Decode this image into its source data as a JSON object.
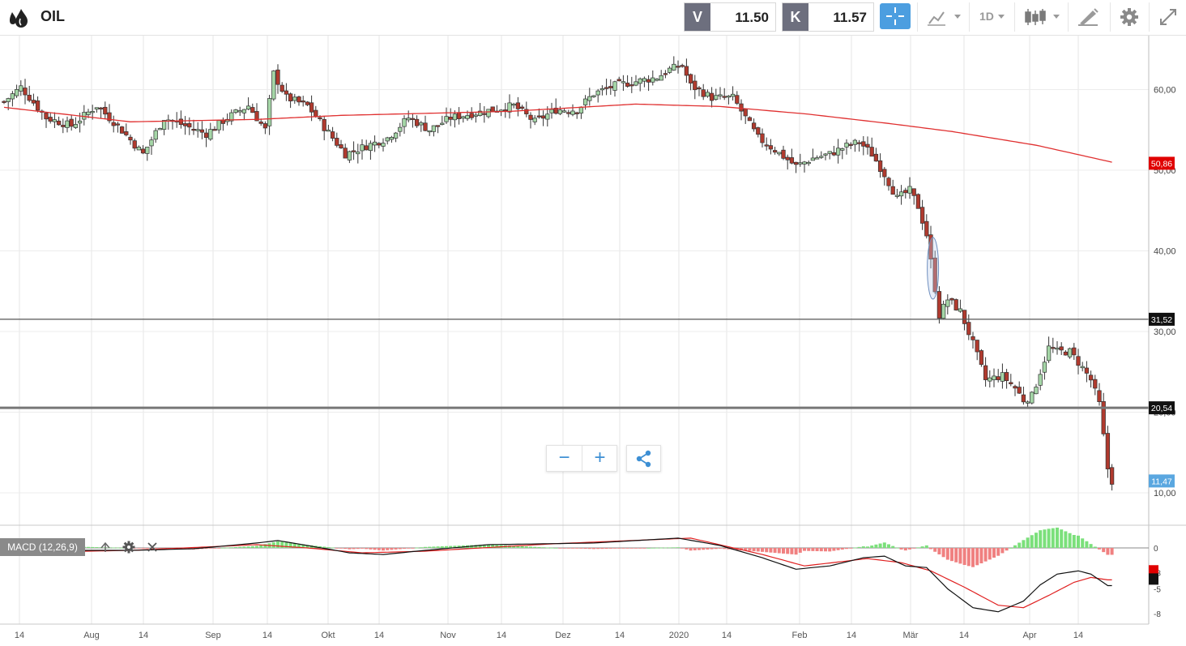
{
  "header": {
    "symbol": "OIL",
    "sell_tag": "V",
    "sell_value": "11.50",
    "buy_tag": "K",
    "buy_value": "11.57",
    "timeframe": "1D",
    "icons": [
      "oil-drop-icon",
      "crosshair-icon",
      "line-chart-icon",
      "candlestick-icon",
      "drawing-tool-icon",
      "gear-icon",
      "fullscreen-icon"
    ]
  },
  "colors": {
    "accent": "#4c9ee0",
    "up_candle": "#a5d6a7",
    "down_candle": "#b03a2e",
    "ma_line": "#e03030",
    "price_tag": "#5aa7e0",
    "macd_pos": "#7be07b",
    "macd_neg": "#f08080"
  },
  "zoom": {
    "minus": "−",
    "plus": "+",
    "share_icon": "share-icon"
  },
  "indicator": {
    "label": "MACD (12,26,9)",
    "tool_icons": [
      "move-icon",
      "gear-icon",
      "close-icon"
    ]
  },
  "chart_data": {
    "type": "candlestick",
    "price_axis": [
      "60,00",
      "50,00",
      "40,00",
      "30,00",
      "20,00",
      "10,00"
    ],
    "macd_axis": [
      "0",
      "-3",
      "-5",
      "-8"
    ],
    "x_ticks": [
      "14",
      "Aug",
      "14",
      "Sep",
      "14",
      "Okt",
      "14",
      "Nov",
      "14",
      "Dez",
      "14",
      "2020",
      "14",
      "Feb",
      "14",
      "Mär",
      "14",
      "Apr",
      "14"
    ],
    "markers": [
      {
        "label": "50,86",
        "value": 50.86,
        "color": "#e00000"
      },
      {
        "label": "31,52",
        "value": 31.52,
        "color": "#111111"
      },
      {
        "label": "20,54",
        "value": 20.54,
        "color": "#111111"
      },
      {
        "label": "11,47",
        "value": 11.47,
        "color": "#5aa7e0"
      }
    ],
    "macd_markers": [
      {
        "value": -2.8,
        "color": "#e00000"
      },
      {
        "value": -3.8,
        "color": "#111111"
      }
    ],
    "horizontal_lines": [
      31.52,
      20.54
    ],
    "anchors": [
      [
        0,
        58.5
      ],
      [
        4,
        60.3
      ],
      [
        10,
        56.5
      ],
      [
        16,
        55.5
      ],
      [
        22,
        58.0
      ],
      [
        27,
        55.5
      ],
      [
        33,
        52.0
      ],
      [
        38,
        56.5
      ],
      [
        43,
        55.5
      ],
      [
        48,
        54.5
      ],
      [
        53,
        56.5
      ],
      [
        58,
        58.0
      ],
      [
        62,
        55.0
      ],
      [
        64,
        62.0
      ],
      [
        67,
        59.0
      ],
      [
        72,
        58.0
      ],
      [
        78,
        54.0
      ],
      [
        81,
        52.0
      ],
      [
        86,
        53.0
      ],
      [
        91,
        54.0
      ],
      [
        96,
        56.5
      ],
      [
        101,
        55.0
      ],
      [
        106,
        56.5
      ],
      [
        111,
        57.0
      ],
      [
        116,
        57.5
      ],
      [
        121,
        58.0
      ],
      [
        126,
        56.0
      ],
      [
        131,
        57.5
      ],
      [
        136,
        57.5
      ],
      [
        140,
        59.5
      ],
      [
        145,
        60.5
      ],
      [
        150,
        61.0
      ],
      [
        155,
        61.5
      ],
      [
        158,
        62.5
      ],
      [
        161,
        63.0
      ],
      [
        163,
        60.5
      ],
      [
        168,
        59.0
      ],
      [
        173,
        59.0
      ],
      [
        176,
        56.5
      ],
      [
        179,
        54.0
      ],
      [
        183,
        52.5
      ],
      [
        188,
        50.5
      ],
      [
        192,
        51.5
      ],
      [
        196,
        52.0
      ],
      [
        200,
        53.0
      ],
      [
        203,
        53.5
      ],
      [
        206,
        52.0
      ],
      [
        209,
        49.5
      ],
      [
        212,
        46.5
      ],
      [
        215,
        47.5
      ],
      [
        217,
        45.5
      ],
      [
        219,
        42.0
      ],
      [
        222,
        32.0
      ],
      [
        224,
        34.0
      ],
      [
        227,
        32.5
      ],
      [
        230,
        28.5
      ],
      [
        233,
        24.0
      ],
      [
        237,
        24.5
      ],
      [
        240,
        23.0
      ],
      [
        242,
        21.5
      ],
      [
        244,
        22.0
      ],
      [
        246,
        25.0
      ],
      [
        248,
        28.0
      ],
      [
        250,
        27.5
      ],
      [
        253,
        27.5
      ],
      [
        256,
        25.5
      ],
      [
        258,
        24.0
      ],
      [
        260,
        21.0
      ],
      [
        262,
        13.0
      ],
      [
        263,
        11.47
      ]
    ],
    "ma200": [
      [
        0,
        57.8
      ],
      [
        30,
        56.0
      ],
      [
        60,
        56.3
      ],
      [
        80,
        56.8
      ],
      [
        120,
        57.3
      ],
      [
        150,
        58.2
      ],
      [
        170,
        57.9
      ],
      [
        190,
        57.0
      ],
      [
        210,
        55.8
      ],
      [
        225,
        54.8
      ],
      [
        245,
        53.1
      ],
      [
        263,
        51.0
      ]
    ],
    "macd_line": [
      [
        0,
        0.0
      ],
      [
        7,
        -0.8
      ],
      [
        14,
        -0.3
      ],
      [
        30,
        -0.3
      ],
      [
        45,
        -0.1
      ],
      [
        60,
        0.6
      ],
      [
        65,
        0.9
      ],
      [
        72,
        0.3
      ],
      [
        82,
        -0.6
      ],
      [
        90,
        -0.8
      ],
      [
        100,
        -0.3
      ],
      [
        115,
        0.4
      ],
      [
        140,
        0.6
      ],
      [
        160,
        1.2
      ],
      [
        170,
        0.3
      ],
      [
        180,
        -1.2
      ],
      [
        188,
        -2.6
      ],
      [
        196,
        -2.2
      ],
      [
        204,
        -1.2
      ],
      [
        209,
        -1.0
      ],
      [
        214,
        -2.2
      ],
      [
        219,
        -2.4
      ],
      [
        224,
        -5.0
      ],
      [
        230,
        -7.3
      ],
      [
        236,
        -7.8
      ],
      [
        242,
        -6.5
      ],
      [
        246,
        -4.5
      ],
      [
        250,
        -3.2
      ],
      [
        255,
        -2.8
      ],
      [
        258,
        -3.2
      ],
      [
        262,
        -4.6
      ]
    ],
    "signal_line": [
      [
        0,
        0.0
      ],
      [
        10,
        -0.5
      ],
      [
        30,
        -0.3
      ],
      [
        60,
        0.4
      ],
      [
        72,
        0.0
      ],
      [
        85,
        -0.6
      ],
      [
        100,
        -0.4
      ],
      [
        130,
        0.5
      ],
      [
        163,
        1.2
      ],
      [
        180,
        -0.8
      ],
      [
        190,
        -2.2
      ],
      [
        205,
        -1.3
      ],
      [
        213,
        -1.8
      ],
      [
        220,
        -2.8
      ],
      [
        228,
        -4.8
      ],
      [
        236,
        -7.0
      ],
      [
        242,
        -7.3
      ],
      [
        248,
        -5.8
      ],
      [
        254,
        -4.2
      ],
      [
        258,
        -3.6
      ],
      [
        262,
        -3.9
      ]
    ]
  }
}
